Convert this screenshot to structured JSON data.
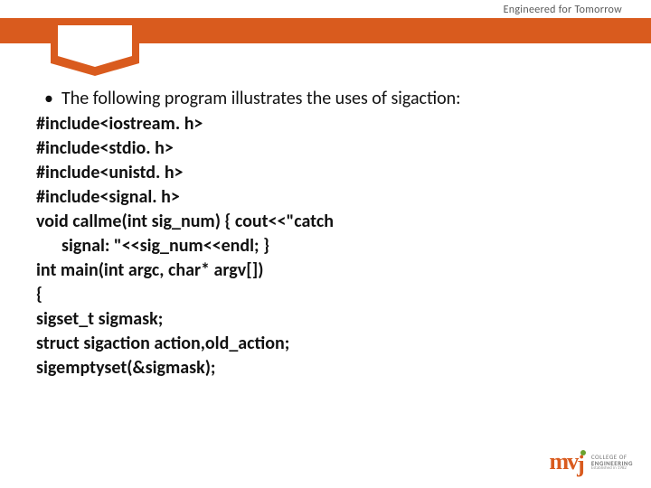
{
  "header": {
    "tagline": "Engineered for Tomorrow"
  },
  "content": {
    "bullet": "•",
    "intro": "The following program illustrates the uses of sigaction:",
    "lines": [
      "#include<iostream. h>",
      "#include<stdio. h>",
      "#include<unistd. h>",
      "#include<signal. h>",
      "void callme(int sig_num) { cout<<\"catch",
      "signal: \"<<sig_num<<endl; }",
      "int main(int argc, char* argv[])",
      " {",
      " sigset_t sigmask;",
      "struct sigaction action,old_action;",
      "sigemptyset(&sigmask);"
    ]
  },
  "logo": {
    "mark": "mvj",
    "line1": "COLLEGE OF",
    "line2": "ENGINEERING",
    "line3": "Established in 1982"
  }
}
